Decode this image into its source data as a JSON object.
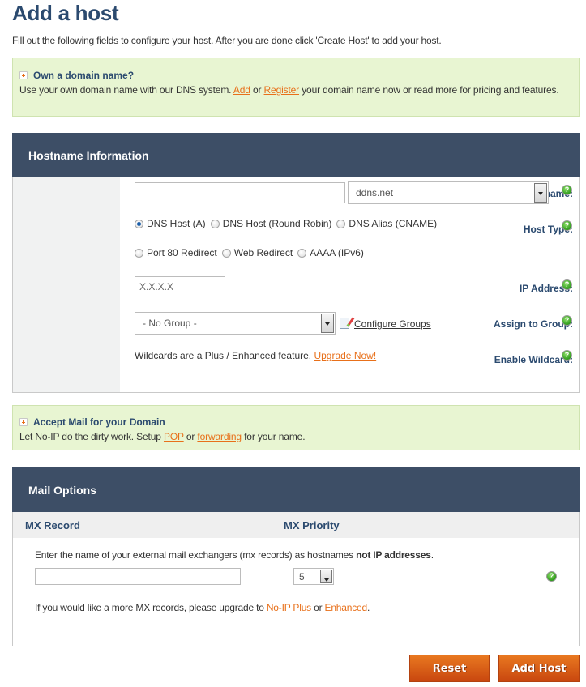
{
  "page": {
    "title": "Add a host",
    "intro": "Fill out the following fields to configure your host. After you are done click 'Create Host' to add your host."
  },
  "domain_callout": {
    "title": "Own a domain name?",
    "text_before": "Use your own domain name with our DNS system. ",
    "link_add": "Add",
    "text_or": " or ",
    "link_register": "Register",
    "text_after": " your domain name now or read more for pricing and features."
  },
  "hostname_section": {
    "header": "Hostname Information",
    "hostname": {
      "label": "Hostname:",
      "value": "",
      "domain_selected": "ddns.net"
    },
    "host_type": {
      "label": "Host Type:",
      "options": [
        {
          "label": "DNS Host (A)",
          "checked": true
        },
        {
          "label": "DNS Host (Round Robin)",
          "checked": false
        },
        {
          "label": "DNS Alias (CNAME)",
          "checked": false
        },
        {
          "label": "Port 80 Redirect",
          "checked": false
        },
        {
          "label": "Web Redirect",
          "checked": false
        },
        {
          "label": "AAAA (IPv6)",
          "checked": false
        }
      ]
    },
    "ip_address": {
      "label": "IP Address:",
      "value": "X.X.X.X"
    },
    "group": {
      "label": "Assign to Group:",
      "selected": "- No Group -",
      "configure_link": "Configure Groups"
    },
    "wildcard": {
      "label": "Enable Wildcard:",
      "text": "Wildcards are a Plus / Enhanced feature. ",
      "upgrade_link": "Upgrade Now!"
    },
    "help_icon": "?"
  },
  "mail_callout": {
    "title": "Accept Mail for your Domain",
    "text_before": "Let No-IP do the dirty work. Setup ",
    "link_pop": "POP",
    "text_or": " or ",
    "link_forwarding": "forwarding",
    "text_after": " for your name."
  },
  "mail_section": {
    "header": "Mail Options",
    "col_record": "MX Record",
    "col_priority": "MX Priority",
    "instruction": "Enter the name of your external mail exchangers (mx records) as hostnames ",
    "instruction_bold": "not IP addresses",
    "instruction_end": ".",
    "mx_value": "",
    "priority_selected": "5",
    "upgrade_text": "If you would like a more MX records, please upgrade to ",
    "link_plus": "No-IP Plus",
    "text_or": " or ",
    "link_enhanced": "Enhanced",
    "upgrade_end": "."
  },
  "buttons": {
    "reset": "Reset",
    "add_host": "Add Host"
  }
}
